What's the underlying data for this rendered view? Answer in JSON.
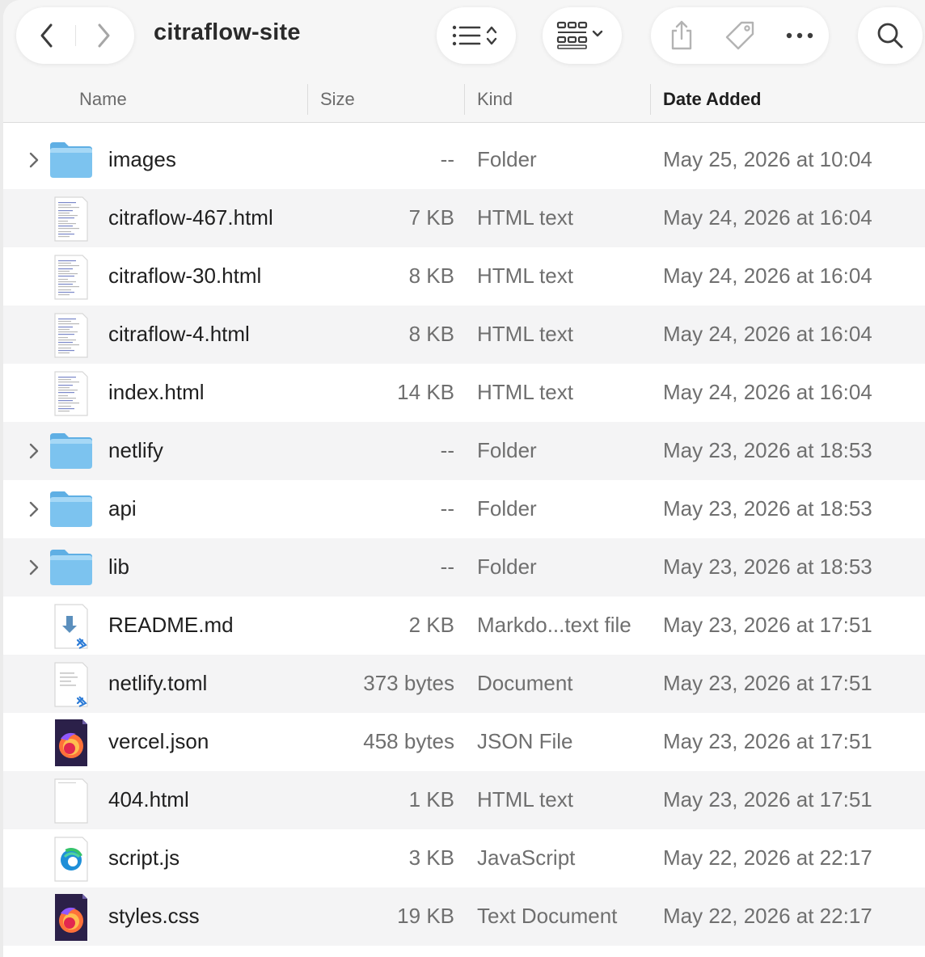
{
  "window": {
    "title": "citraflow-site"
  },
  "columns": {
    "name": "Name",
    "size": "Size",
    "kind": "Kind",
    "date_added": "Date Added"
  },
  "icons": {
    "back": "chevron-left-icon",
    "forward": "chevron-right-icon",
    "list_view": "list-view-icon",
    "grid_view": "grid-view-icon",
    "share": "share-icon",
    "tag": "tag-icon",
    "more": "ellipsis-icon",
    "search": "search-icon"
  },
  "colors": {
    "folder": "#7cc3ef",
    "row_alt": "#f4f4f5",
    "toolbar": "#f6f6f6"
  },
  "files": [
    {
      "name": "images",
      "size": "--",
      "kind": "Folder",
      "date": "May 25, 2026 at 10:04",
      "type": "folder"
    },
    {
      "name": "citraflow-467.html",
      "size": "7 KB",
      "kind": "HTML text",
      "date": "May 24, 2026 at 16:04",
      "type": "doc"
    },
    {
      "name": "citraflow-30.html",
      "size": "8 KB",
      "kind": "HTML text",
      "date": "May 24, 2026 at 16:04",
      "type": "doc"
    },
    {
      "name": "citraflow-4.html",
      "size": "8 KB",
      "kind": "HTML text",
      "date": "May 24, 2026 at 16:04",
      "type": "doc"
    },
    {
      "name": "index.html",
      "size": "14 KB",
      "kind": "HTML text",
      "date": "May 24, 2026 at 16:04",
      "type": "doc"
    },
    {
      "name": "netlify",
      "size": "--",
      "kind": "Folder",
      "date": "May 23, 2026 at 18:53",
      "type": "folder"
    },
    {
      "name": "api",
      "size": "--",
      "kind": "Folder",
      "date": "May 23, 2026 at 18:53",
      "type": "folder"
    },
    {
      "name": "lib",
      "size": "--",
      "kind": "Folder",
      "date": "May 23, 2026 at 18:53",
      "type": "folder"
    },
    {
      "name": "README.md",
      "size": "2 KB",
      "kind": "Markdo...text file",
      "date": "May 23, 2026 at 17:51",
      "type": "markdown"
    },
    {
      "name": "netlify.toml",
      "size": "373 bytes",
      "kind": "Document",
      "date": "May 23, 2026 at 17:51",
      "type": "toml"
    },
    {
      "name": "vercel.json",
      "size": "458 bytes",
      "kind": "JSON File",
      "date": "May 23, 2026 at 17:51",
      "type": "firefox"
    },
    {
      "name": "404.html",
      "size": "1 KB",
      "kind": "HTML text",
      "date": "May 23, 2026 at 17:51",
      "type": "blank"
    },
    {
      "name": "script.js",
      "size": "3 KB",
      "kind": "JavaScript",
      "date": "May 22, 2026 at 22:17",
      "type": "edge"
    },
    {
      "name": "styles.css",
      "size": "19 KB",
      "kind": "Text Document",
      "date": "May 22, 2026 at 22:17",
      "type": "firefox"
    }
  ]
}
